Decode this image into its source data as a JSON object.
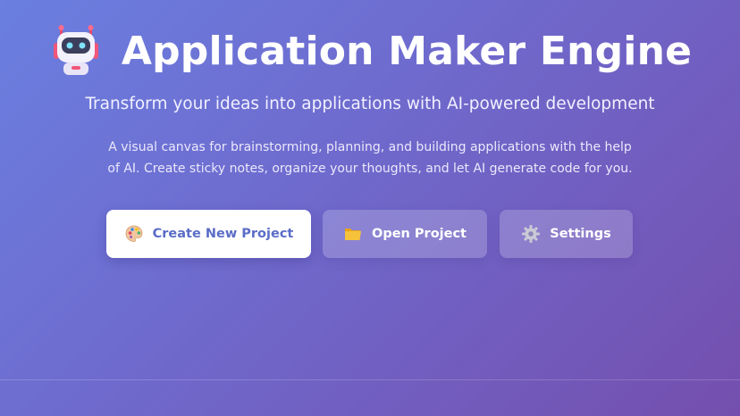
{
  "app": {
    "title": "Application Maker Engine",
    "logo_icon": "robot-icon",
    "subtitle": "Transform your ideas into applications with AI-powered development",
    "description": "A visual canvas for brainstorming, planning, and building applications with the help of AI. Create sticky notes, organize your thoughts, and let AI generate code for you."
  },
  "actions": {
    "create": {
      "label": "Create New Project",
      "icon": "palette-icon"
    },
    "open": {
      "label": "Open Project",
      "icon": "folder-icon"
    },
    "settings": {
      "label": "Settings",
      "icon": "gear-icon"
    }
  },
  "colors": {
    "gradient_start": "#6a7fe0",
    "gradient_end": "#744fae",
    "primary_button_text": "#5b6cc7",
    "primary_button_bg": "#ffffff"
  }
}
